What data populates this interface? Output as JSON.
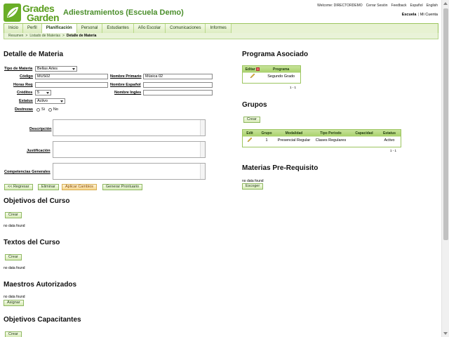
{
  "header": {
    "logo_line1": "Grades",
    "logo_line2": "Garden",
    "app_title": "Adiestramientos (Escuela Demo)",
    "top_links": {
      "welcome": "Welcome: DIRECTORDEMO",
      "logout": "Cerrar Sesión",
      "feedback": "Feedback",
      "spanish": "Español",
      "english": "English"
    },
    "school_link": "Escuela",
    "separator": "|",
    "account_link": "Mi Cuenta"
  },
  "nav": {
    "tabs": [
      "Inicio",
      "Perfil",
      "Planificación",
      "Personal",
      "Estudiantes",
      "Año Escolar",
      "Comunicaciones",
      "Informes"
    ],
    "active": "Planificación"
  },
  "breadcrumb": {
    "items": [
      "Resumen",
      "Listado de Materias",
      "Detalle de Materia"
    ],
    "sep": ">"
  },
  "detalle": {
    "title": "Detalle de Materia",
    "tipo_label": "Tipo de Materia",
    "tipo_value": "Bellas Artes",
    "codigo_label": "Código",
    "codigo_value": "MUS02",
    "nombre_primario_label": "Nombre Primario",
    "nombre_primario_value": "Música 02",
    "horas_label": "Horas Req",
    "horas_value": "",
    "nombre_espanol_label": "Nombre Español",
    "nombre_espanol_value": "",
    "creditos_label": "Créditos",
    "creditos_value": "5",
    "nombre_ingles_label": "Nombre Ingles",
    "nombre_ingles_value": "",
    "estatus_label": "Estatus",
    "estatus_value": "Activo",
    "destrezas_label": "Destrezas",
    "si_label": "Si",
    "no_label": "No",
    "descripcion_label": "Descripción",
    "justificacion_label": "Justificación",
    "competencias_label": "Competencias Generales",
    "btn_regresar": "<< Regresar",
    "btn_eliminar": "Eliminar",
    "btn_aplicar": "Aplicar Cambios",
    "btn_prontuario": "Generar Prontuario"
  },
  "objetivos": {
    "title": "Objetivos del Curso",
    "btn": "Crear",
    "empty": "no data found"
  },
  "textos": {
    "title": "Textos del Curso",
    "btn": "Crear",
    "empty": "no data found"
  },
  "maestros": {
    "title": "Maestros Autorizados",
    "empty": "no data found",
    "btn": "Asignar"
  },
  "capacitantes": {
    "title": "Objetivos Capacitantes",
    "btn": "Crear"
  },
  "programa": {
    "title": "Programa Asociado",
    "headers": [
      "Editar",
      "Programa"
    ],
    "rows": [
      {
        "programa": "Segundo Grado"
      }
    ],
    "pager": "1 - 1"
  },
  "grupos": {
    "title": "Grupos",
    "btn": "Crear",
    "headers": [
      "Edit",
      "Grupo",
      "Modalidad",
      "Tipo Periodo",
      "Capacidad",
      "Estatus"
    ],
    "rows": [
      {
        "grupo": "1",
        "modalidad": "Presencial Regular",
        "tipo": "Clases Regulares",
        "capacidad": "",
        "estatus": "Activo"
      }
    ],
    "pager": "1 - 1"
  },
  "prereq": {
    "title": "Materias Pre-Requisito",
    "empty": "no data found",
    "btn": "Escoger"
  },
  "colors": {
    "brand_green": "#5a9e1e",
    "nav_bg": "#e7f2d2",
    "table_head": "#a9d16c",
    "orange_btn": "#f5d58a"
  }
}
